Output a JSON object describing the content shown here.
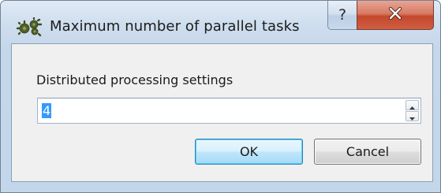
{
  "window": {
    "title": "Maximum number of parallel tasks",
    "help_glyph": "?",
    "app_icon": "gear-cluster-icon",
    "help_icon": "question-mark-icon",
    "close_icon": "close-x-icon"
  },
  "settings": {
    "group_label": "Distributed processing settings",
    "parallel_tasks_value": "4",
    "up_icon": "spin-up-arrow-icon",
    "down_icon": "spin-down-arrow-icon"
  },
  "buttons": {
    "ok_label": "OK",
    "cancel_label": "Cancel"
  },
  "colors": {
    "selection": "#3399ff",
    "close_button": "#c4472d",
    "ok_focus_border": "#3c7fb1"
  }
}
